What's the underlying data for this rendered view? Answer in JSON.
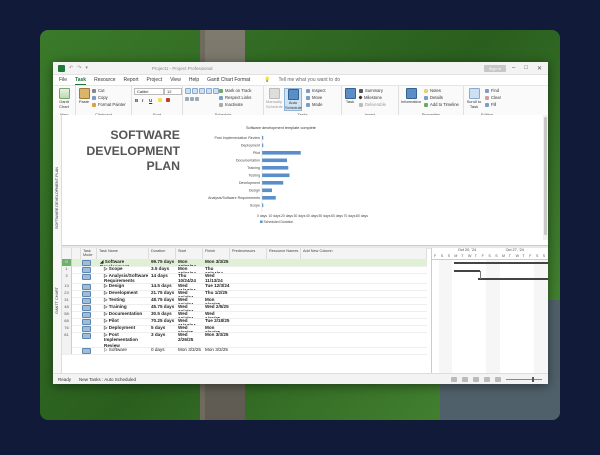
{
  "window": {
    "title": "Project1 - Project Professional",
    "sign_in": "Sign in",
    "controls": [
      "–",
      "□",
      "✕"
    ]
  },
  "menu": {
    "tabs": [
      "File",
      "Task",
      "Resource",
      "Report",
      "Project",
      "View",
      "Help",
      "Gantt Chart Format"
    ],
    "active": "Task",
    "tell_me": "Tell me what you want to do"
  },
  "ribbon": {
    "view": {
      "gantt": "Gantt Chart",
      "label": "View"
    },
    "clipboard": {
      "paste": "Paste",
      "cut": "Cut",
      "copy": "Copy",
      "format_painter": "Format Painter",
      "label": "Clipboard"
    },
    "font": {
      "name": "Calibri",
      "size": "12",
      "bold": "B",
      "italic": "I",
      "underline": "U",
      "label": "Font"
    },
    "schedule": {
      "mark_on_track": "Mark on Track",
      "respect_links": "Respect Links",
      "inactivate": "Inactivate",
      "label": "Schedule"
    },
    "tasks": {
      "manually": "Manually Schedule",
      "auto": "Auto Schedule",
      "inspect": "Inspect",
      "move": "Move",
      "mode": "Mode",
      "label": "Tasks"
    },
    "insert": {
      "task": "Task",
      "summary": "Summary",
      "milestone": "Milestone",
      "deliverable": "Deliverable",
      "label": "Insert"
    },
    "properties": {
      "information": "Information",
      "notes": "Notes",
      "details": "Details",
      "add_timeline": "Add to Timeline",
      "label": "Properties"
    },
    "editing": {
      "scroll": "Scroll to Task",
      "find": "Find",
      "clear": "Clear",
      "fill": "Fill",
      "label": "Editing"
    }
  },
  "sidebar": {
    "top_label": "SOFTWARE DEVELOPMENT PLAN",
    "bottom_label": "GANTT CHART"
  },
  "report": {
    "title_lines": [
      "SOFTWARE",
      "DEVELOPMENT",
      "PLAN"
    ]
  },
  "chart_data": {
    "type": "bar",
    "title": "Software development template complete",
    "categories": [
      "Post Implementation Review",
      "Deployment",
      "Pilot",
      "Documentation",
      "Training",
      "Testing",
      "Development",
      "Design",
      "Analysis/Software Requirements",
      "Scope"
    ],
    "series": [
      {
        "name": "Scheduled Duration",
        "values": [
          1,
          1,
          31,
          20,
          21,
          22,
          17,
          8,
          11,
          1
        ]
      }
    ],
    "x_ticks": [
      "0 days",
      "10 days",
      "20 days",
      "30 days",
      "40 days",
      "50 days",
      "60 days",
      "70 days",
      "80 days"
    ],
    "xlim": [
      0,
      80
    ],
    "legend": "bottom"
  },
  "table": {
    "headers": [
      "Task Mode",
      "Task Name",
      "Duration",
      "Start",
      "Finish",
      "Predecessors",
      "Resource Names",
      "Add New Column"
    ],
    "rows": [
      {
        "num": "0",
        "indent": 0,
        "expand": "◢",
        "name": "Software Development",
        "duration": "99.75 days",
        "start": "Mon 10/21/24",
        "finish": "Mon 3/3/25",
        "bold": true,
        "selected": true
      },
      {
        "num": "1",
        "indent": 1,
        "expand": "▷",
        "name": "Scope",
        "duration": "3.5 days",
        "start": "Mon 10/21/24",
        "finish": "Thu 10/24/24",
        "bold": true
      },
      {
        "num": "3",
        "indent": 1,
        "expand": "▷",
        "name": "Analysis/Software Requirements",
        "duration": "14 days",
        "start": "Thu 10/24/24",
        "finish": "Wed 11/13/24",
        "bold": true
      },
      {
        "num": "13",
        "indent": 1,
        "expand": "▷",
        "name": "Design",
        "duration": "14.5 days",
        "start": "Wed 11/13/24",
        "finish": "Tue 12/3/24",
        "bold": true
      },
      {
        "num": "23",
        "indent": 1,
        "expand": "▷",
        "name": "Development",
        "duration": "21.75 days",
        "start": "Wed 12/4/24",
        "finish": "Thu 1/2/25",
        "bold": true
      },
      {
        "num": "31",
        "indent": 1,
        "expand": "▷",
        "name": "Testing",
        "duration": "48.75 days",
        "start": "Wed 12/4/24",
        "finish": "Mon 2/10/25",
        "bold": true
      },
      {
        "num": "48",
        "indent": 1,
        "expand": "▷",
        "name": "Training",
        "duration": "45.75 days",
        "start": "Wed 12/4/24",
        "finish": "Wed 2/5/25",
        "bold": true
      },
      {
        "num": "58",
        "indent": 1,
        "expand": "▷",
        "name": "Documentation",
        "duration": "30.5 days",
        "start": "Wed 12/4/24",
        "finish": "Wed 1/15/25",
        "bold": true
      },
      {
        "num": "68",
        "indent": 1,
        "expand": "▷",
        "name": "Pilot",
        "duration": "70.25 days",
        "start": "Wed 11/13/24",
        "finish": "Tue 2/18/25",
        "bold": true
      },
      {
        "num": "76",
        "indent": 1,
        "expand": "▷",
        "name": "Deployment",
        "duration": "5 days",
        "start": "Wed 2/19/25",
        "finish": "Mon 2/24/25",
        "bold": true
      },
      {
        "num": "81",
        "indent": 1,
        "expand": "▷",
        "name": "Post Implementation Review",
        "duration": "3 days",
        "start": "Wed 2/26/25",
        "finish": "Mon 3/3/25",
        "bold": true
      },
      {
        "num": "",
        "indent": 1,
        "expand": "▷",
        "name": "Software",
        "duration": "0 days",
        "start": "Mon 3/3/25",
        "finish": "Mon 3/3/25",
        "bold": false
      }
    ]
  },
  "timescale": {
    "weeks": [
      "Oct 20, '24",
      "Oct 27, '24"
    ],
    "days": [
      "F",
      "S",
      "S",
      "M",
      "T",
      "W",
      "T",
      "F",
      "S",
      "S",
      "M",
      "T",
      "W",
      "T",
      "F",
      "S",
      "S"
    ]
  },
  "status": {
    "ready": "Ready",
    "new_tasks": "New Tasks : Auto Scheduled"
  }
}
